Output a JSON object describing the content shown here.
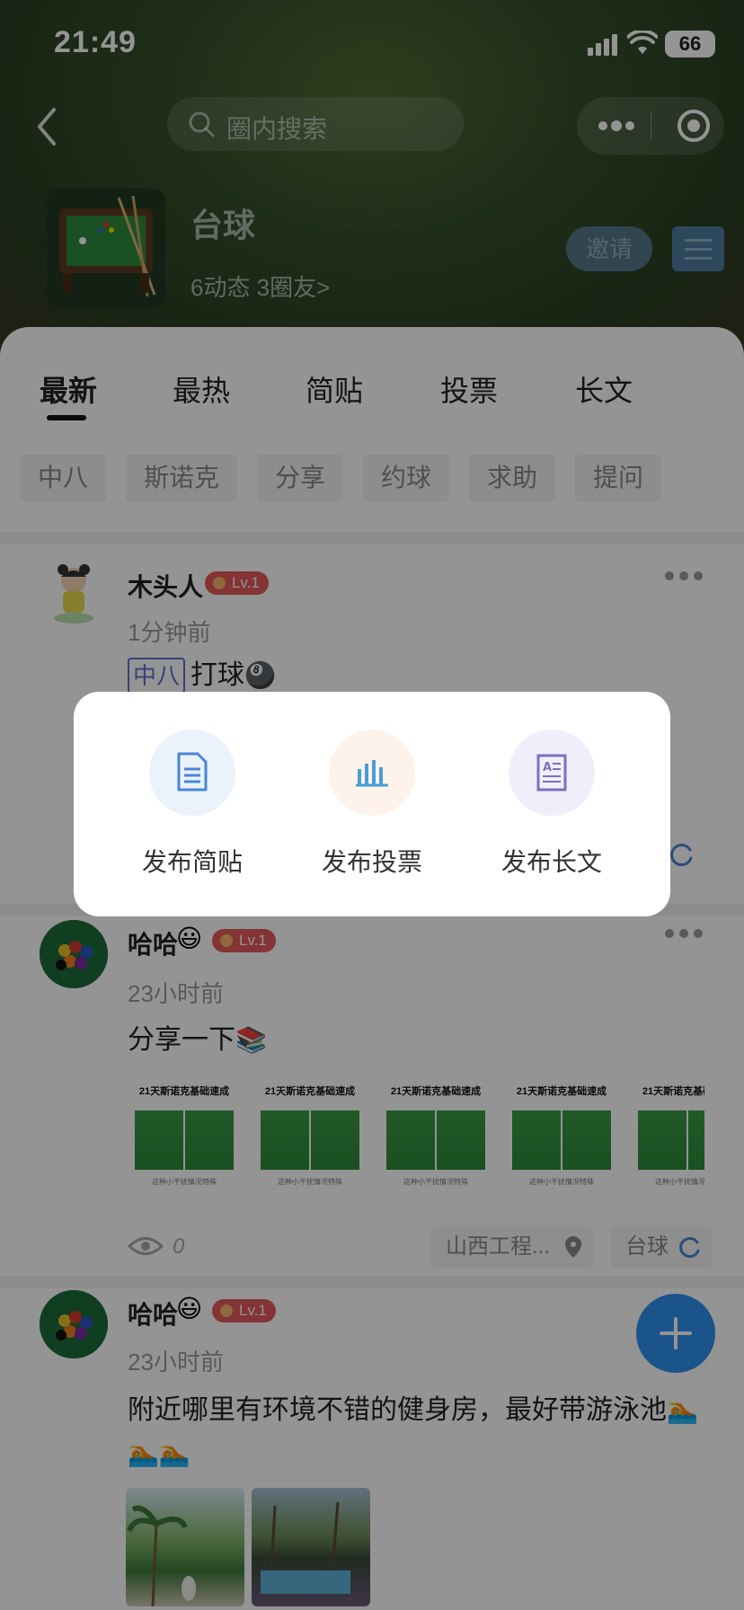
{
  "status_bar": {
    "time": "21:49",
    "battery": "66"
  },
  "header": {
    "search_placeholder": "圈内搜索",
    "circle_name": "台球",
    "circle_meta": "6动态 3圈友>",
    "invite_label": "邀请"
  },
  "tabs": [
    {
      "label": "最新",
      "active": true
    },
    {
      "label": "最热"
    },
    {
      "label": "简贴"
    },
    {
      "label": "投票"
    },
    {
      "label": "长文"
    }
  ],
  "chips": [
    "中八",
    "斯诺克",
    "分享",
    "约球",
    "求助",
    "提问"
  ],
  "posts": [
    {
      "username": "木头人",
      "level": "Lv.1",
      "time": "1分钟前",
      "tag": "中八",
      "text": "打球"
    },
    {
      "username": "哈哈",
      "level": "Lv.1",
      "time": "23小时前",
      "text": "分享一下",
      "image_title": "21天斯诺克基础速成",
      "image_caption": "这种小干扰情况特殊",
      "views": "0",
      "location": "山西工程...",
      "circle": "台球"
    },
    {
      "username": "哈哈",
      "level": "Lv.1",
      "time": "23小时前",
      "text": "附近哪里有环境不错的健身房，最好带游泳池"
    }
  ],
  "popup": {
    "items": [
      {
        "label": "发布简贴",
        "icon": "document-icon",
        "color": "#eaf2fc"
      },
      {
        "label": "发布投票",
        "icon": "bar-chart-icon",
        "color": "#fdf3ea"
      },
      {
        "label": "发布长文",
        "icon": "article-icon",
        "color": "#f1eefc"
      }
    ]
  },
  "colors": {
    "accent_blue": "#2f8ff0",
    "badge_red": "#e35a5a",
    "tag_purple": "#6170c9"
  }
}
